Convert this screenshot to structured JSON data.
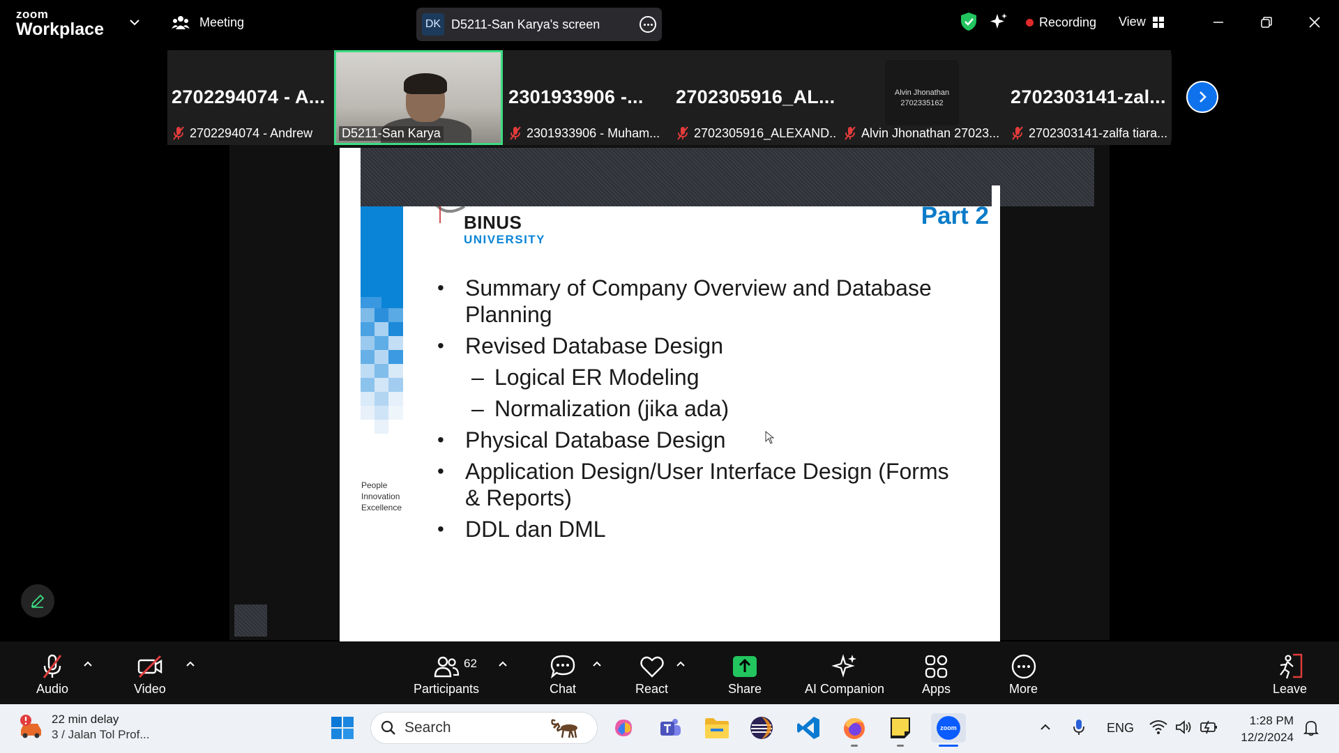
{
  "app": {
    "logo_line1": "zoom",
    "logo_line2": "Workplace",
    "meeting_label": "Meeting",
    "screen_initials": "DK",
    "screen_label": "D5211-San Karya's screen",
    "recording_label": "Recording",
    "view_label": "View"
  },
  "strip": {
    "tiles": [
      {
        "big": "2702294074 - A...",
        "name": "2702294074 - Andrew"
      },
      {
        "big": "",
        "name": "D5211-San Karya"
      },
      {
        "big": "2301933906 -...",
        "name": "2301933906 - Muham..."
      },
      {
        "big": "2702305916_AL...",
        "name": "2702305916_ALEXAND..."
      },
      {
        "big": "",
        "name": "Alvin Jhonathan 27023...",
        "card_line1": "Alvin Jhonathan",
        "card_line2": "2702335162"
      },
      {
        "big": "2702303141-zal...",
        "name": "2702303141-zalfa tiara..."
      }
    ]
  },
  "slide": {
    "brand": "BINUS",
    "brand_sub": "UNIVERSITY",
    "part": "Part 2",
    "tagline1": "People",
    "tagline2": "Innovation",
    "tagline3": "Excellence",
    "items": [
      "Summary of Company Overview and Database Planning",
      "Revised Database Design",
      "Logical ER Modeling",
      "Normalization (jika ada)",
      "Physical Database Design",
      "Application Design/User Interface Design (Forms & Reports)",
      "DDL dan DML"
    ]
  },
  "controls": {
    "audio": "Audio",
    "video": "Video",
    "participants": "Participants",
    "participant_count": "62",
    "chat": "Chat",
    "react": "React",
    "share": "Share",
    "ai": "AI Companion",
    "apps": "Apps",
    "more": "More",
    "leave": "Leave"
  },
  "taskbar": {
    "weather_line1": "22 min delay",
    "weather_line2": "3 / Jalan Tol Prof...",
    "search_placeholder": "Search",
    "lang": "ENG",
    "time": "1:28 PM",
    "date": "12/2/2024"
  },
  "colors": {
    "zoom_blue": "#0e72ed",
    "active_speaker": "#3ddc84",
    "binus_blue": "#0a84d6",
    "recording_red": "#e02a2a",
    "share_green": "#22c55e"
  }
}
